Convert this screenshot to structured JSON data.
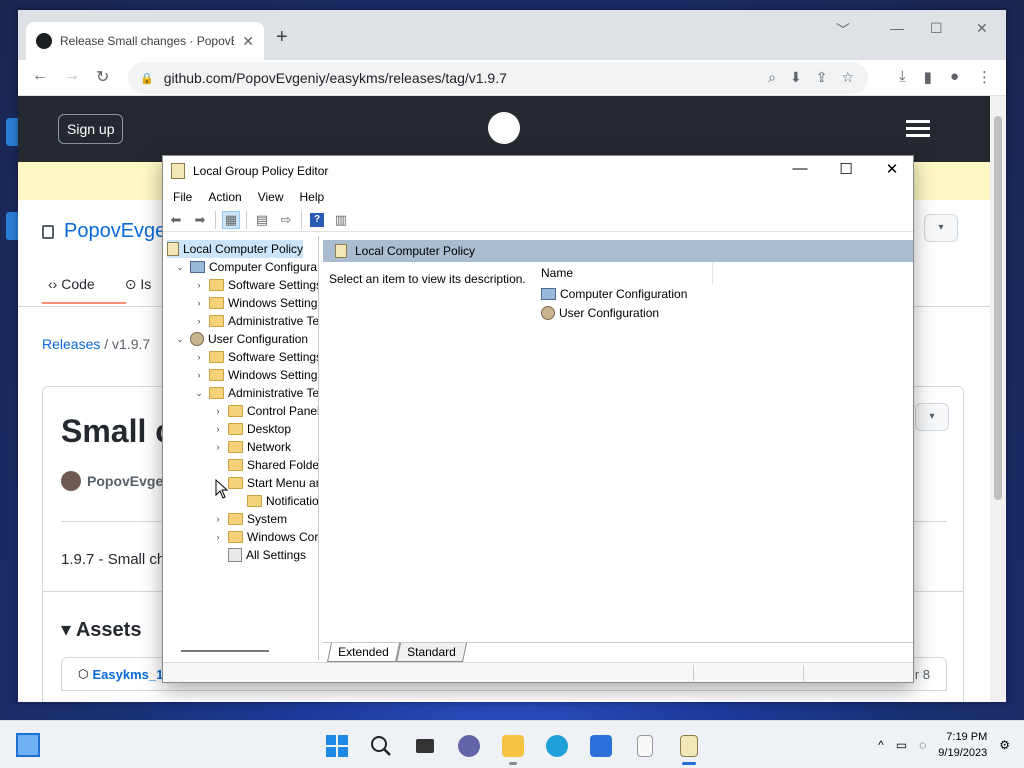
{
  "browser": {
    "tab_title": "Release Small changes · PopovE",
    "tab_close": "✕",
    "new_tab": "+",
    "url": "github.com/PopovEvgeniy/easykms/releases/tag/v1.9.7",
    "win_minimize": "﹀",
    "win_restore": "☐",
    "win_close": "✕"
  },
  "github": {
    "signup": "Sign up",
    "repo_owner": "PopovEvge",
    "tabs": [
      "Code",
      "Is"
    ],
    "breadcrumb_link": "Releases",
    "breadcrumb_sep": "/",
    "breadcrumb_current": "v1.9.7",
    "release_title": "Small c",
    "author": "PopovEvgen",
    "release_desc": "1.9.7 - Small ch",
    "assets_heading": "Assets",
    "asset_name": "Easykms_1.",
    "asset_date": "r 8"
  },
  "gpe": {
    "title": "Local Group Policy Editor",
    "menu": [
      "File",
      "Action",
      "View",
      "Help"
    ],
    "tree": [
      {
        "label": "Local Computer Policy",
        "indent": 0,
        "twisty": "",
        "icon": "doc",
        "selected": true
      },
      {
        "label": "Computer Configura",
        "indent": 1,
        "twisty": "⌄",
        "icon": "computer"
      },
      {
        "label": "Software Settings",
        "indent": 2,
        "twisty": "›",
        "icon": "folder"
      },
      {
        "label": "Windows Setting",
        "indent": 2,
        "twisty": "›",
        "icon": "folder"
      },
      {
        "label": "Administrative Te",
        "indent": 2,
        "twisty": "›",
        "icon": "folder"
      },
      {
        "label": "User Configuration",
        "indent": 1,
        "twisty": "⌄",
        "icon": "user"
      },
      {
        "label": "Software Settings",
        "indent": 2,
        "twisty": "›",
        "icon": "folder"
      },
      {
        "label": "Windows Setting",
        "indent": 2,
        "twisty": "›",
        "icon": "folder"
      },
      {
        "label": "Administrative Te",
        "indent": 2,
        "twisty": "⌄",
        "icon": "folder"
      },
      {
        "label": "Control Panel",
        "indent": 3,
        "twisty": "›",
        "icon": "folder"
      },
      {
        "label": "Desktop",
        "indent": 3,
        "twisty": "›",
        "icon": "folder"
      },
      {
        "label": "Network",
        "indent": 3,
        "twisty": "›",
        "icon": "folder"
      },
      {
        "label": "Shared Folder",
        "indent": 3,
        "twisty": "",
        "icon": "folder"
      },
      {
        "label": "Start Menu ar",
        "indent": 3,
        "twisty": "",
        "icon": "folder"
      },
      {
        "label": "Notificatio",
        "indent": 4,
        "twisty": "",
        "icon": "folder"
      },
      {
        "label": "System",
        "indent": 3,
        "twisty": "›",
        "icon": "folder"
      },
      {
        "label": "Windows Cor",
        "indent": 3,
        "twisty": "›",
        "icon": "folder"
      },
      {
        "label": "All Settings",
        "indent": 3,
        "twisty": "",
        "icon": "allset"
      }
    ],
    "pane_header": "Local Computer Policy",
    "pane_desc": "Select an item to view its description.",
    "col_name": "Name",
    "items": [
      "Computer Configuration",
      "User Configuration"
    ],
    "tab_extended": "Extended",
    "tab_standard": "Standard"
  },
  "taskbar": {
    "time": "7:19 PM",
    "date": "9/19/2023",
    "tray_chevron": "^"
  },
  "colors": {
    "accent": "#1e6fd6",
    "selection": "#cce4f7",
    "pane_header": "#a9bcd0"
  }
}
